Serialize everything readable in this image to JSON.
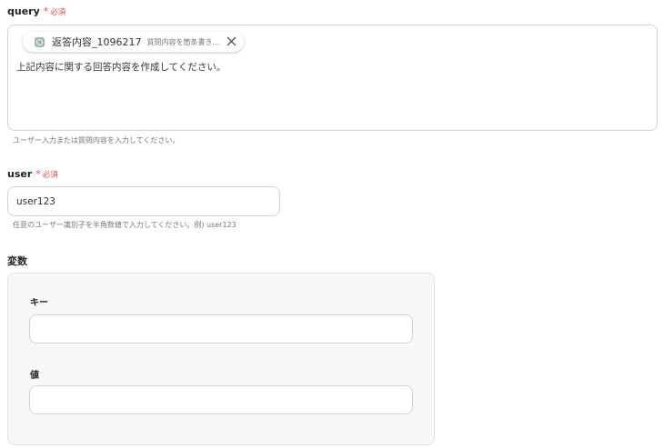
{
  "fields": {
    "query": {
      "label": "query",
      "required_mark": "*",
      "required_text": "必須",
      "chip": {
        "name": "返答内容_1096217",
        "description": "質問内容を箇条書き...",
        "icon": "chat-node-icon"
      },
      "value": "上記内容に関する回答内容を作成してください。",
      "hint": "ユーザー入力または質問内容を入力してください。"
    },
    "user": {
      "label": "user",
      "required_mark": "*",
      "required_text": "必須",
      "value": "user123",
      "hint": "任意のユーザー識別子を半角数値で入力してください。例) user123"
    },
    "variables": {
      "label": "変数",
      "key_label": "キー",
      "key_value": "",
      "value_label": "値",
      "value_value": ""
    }
  },
  "colors": {
    "required": "#e8484e",
    "border": "#d4d4d4",
    "panel_bg": "#f7f7f7"
  }
}
